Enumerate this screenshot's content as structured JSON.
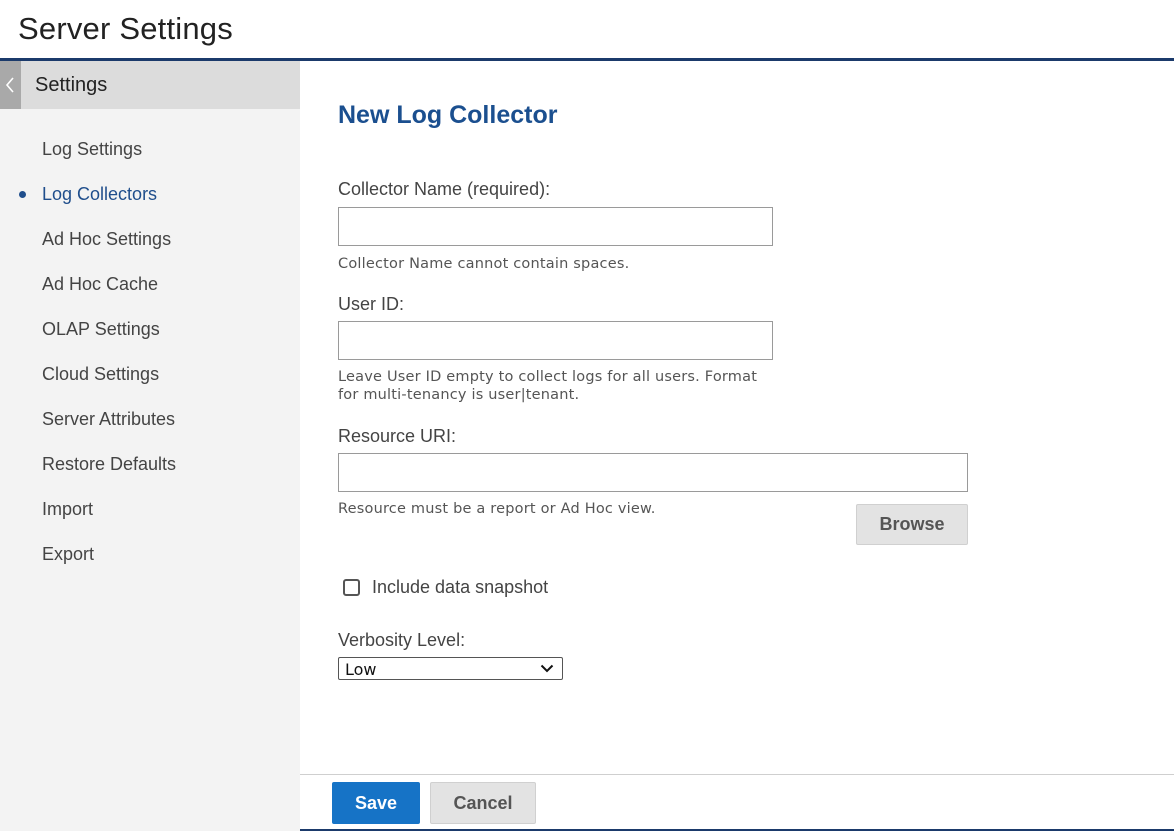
{
  "header": {
    "title": "Server Settings"
  },
  "sidebar": {
    "title": "Settings",
    "items": [
      {
        "label": "Log Settings",
        "active": false
      },
      {
        "label": "Log Collectors",
        "active": true
      },
      {
        "label": "Ad Hoc Settings",
        "active": false
      },
      {
        "label": "Ad Hoc Cache",
        "active": false
      },
      {
        "label": "OLAP Settings",
        "active": false
      },
      {
        "label": "Cloud Settings",
        "active": false
      },
      {
        "label": "Server Attributes",
        "active": false
      },
      {
        "label": "Restore Defaults",
        "active": false
      },
      {
        "label": "Import",
        "active": false
      },
      {
        "label": "Export",
        "active": false
      }
    ]
  },
  "form": {
    "title": "New Log Collector",
    "collector_name": {
      "label": "Collector Name (required):",
      "value": "",
      "hint": "Collector Name cannot contain spaces."
    },
    "user_id": {
      "label": "User ID:",
      "value": "",
      "hint_line1": "Leave User ID empty to collect logs for all users. Format",
      "hint_line2": "for multi-tenancy is user|tenant."
    },
    "resource_uri": {
      "label": "Resource URI:",
      "value": "",
      "hint": "Resource must be a report or Ad Hoc view.",
      "browse_label": "Browse"
    },
    "snapshot": {
      "label": "Include data snapshot",
      "checked": false
    },
    "verbosity": {
      "label": "Verbosity Level:",
      "value": "Low"
    }
  },
  "footer": {
    "save_label": "Save",
    "cancel_label": "Cancel"
  },
  "colors": {
    "accent": "#1b4f8f",
    "primary_button": "#1673c6",
    "header_rule": "#1b3a6b",
    "sidebar_bg": "#f3f3f3"
  },
  "icons": {
    "collapse": "chevron-left-icon",
    "select": "chevron-down-icon"
  }
}
